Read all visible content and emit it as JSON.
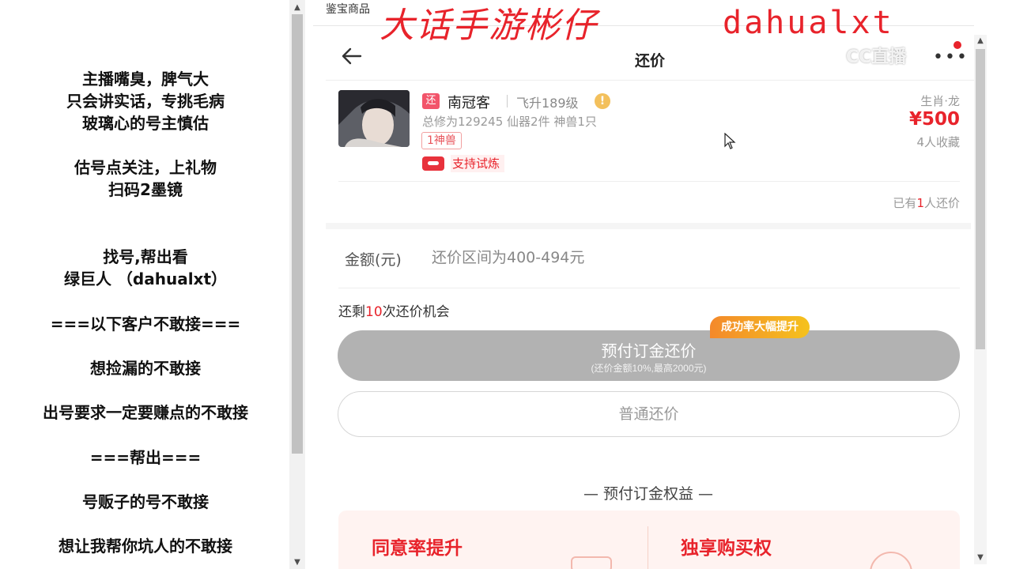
{
  "left_panel": {
    "notes": [
      "主播嘴臭，脾气大",
      "只会讲实话，专挑毛病",
      "玻璃心的号主慎估",
      "估号点关注，上礼物",
      "扫码2墨镜",
      "找号,帮出看",
      "绿巨人 （dahualxt）",
      "===以下客户不敢接===",
      "想捡漏的不敢接",
      "出号要求一定要赚点的不敢接",
      "===帮出===",
      "号贩子的号不敢接",
      "想让我帮你坑人的不敢接"
    ]
  },
  "overlay": {
    "top_label": "鉴宝商品",
    "title": "大话手游彬仔",
    "streamer_id": "dahualxt",
    "watermark": "CC直播"
  },
  "nav": {
    "title": "还价",
    "back_icon": "arrow-left-icon",
    "more_icon": "more-dots-icon"
  },
  "product": {
    "badge": "还",
    "name": "南冠客",
    "level": "飞升189级",
    "warn": "!",
    "stats": "总修为129245  仙器2件  神兽1只",
    "tag": "1神兽",
    "trial": "支持试炼",
    "zodiac": "生肖·龙",
    "price": "¥500",
    "favorites": "4人收藏",
    "offer_prefix": "已有",
    "offer_count": "1",
    "offer_suffix": "人还价"
  },
  "offer_form": {
    "amount_label": "金额(元)",
    "amount_placeholder": "还价区间为400-494元",
    "chances_prefix": "还剩",
    "chances_count": "10",
    "chances_suffix": "次还价机会"
  },
  "buttons": {
    "prepay_label": "预付订金还价",
    "prepay_sub": "(还价金额10%,最高2000元)",
    "success_badge": "成功率大幅提升",
    "normal_label": "普通还价"
  },
  "benefits": {
    "title": "—  预付订金权益  —",
    "items": [
      "同意率提升",
      "独享购买权"
    ]
  },
  "colors": {
    "accent_red": "#e8232b",
    "button_gray": "#b2b2b2",
    "badge_orange": "#f4892b"
  }
}
